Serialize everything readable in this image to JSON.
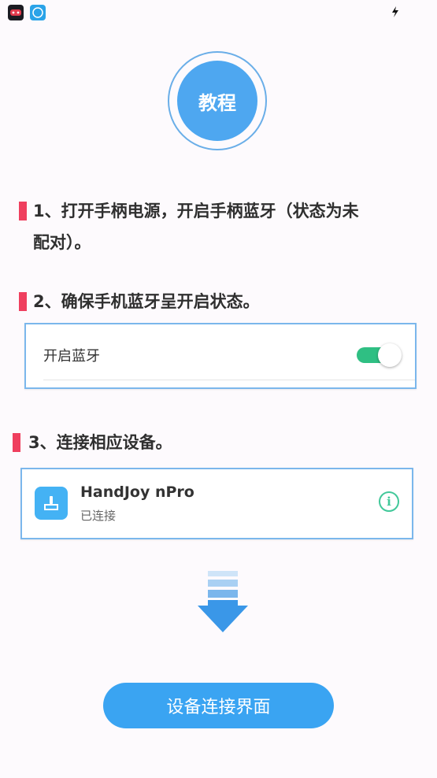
{
  "tutorial_badge": {
    "label": "教程"
  },
  "steps": [
    {
      "line1": "1、打开手柄电源，开启手柄蓝牙（状态为未",
      "line2": "配对）。"
    },
    {
      "line1": "2、确保手机蓝牙呈开启状态。"
    },
    {
      "line1": "3、连接相应设备。"
    }
  ],
  "bluetooth_card": {
    "label": "开启蓝牙",
    "toggle_on": true
  },
  "device_card": {
    "name": "HandJoy nPro",
    "status": "已连接"
  },
  "connect_button": {
    "label": "设备连接界面"
  },
  "colors": {
    "accent": "#3aa4f2",
    "marker": "#ef3f5e",
    "toggle": "#2fbf83",
    "info": "#42c89a"
  }
}
